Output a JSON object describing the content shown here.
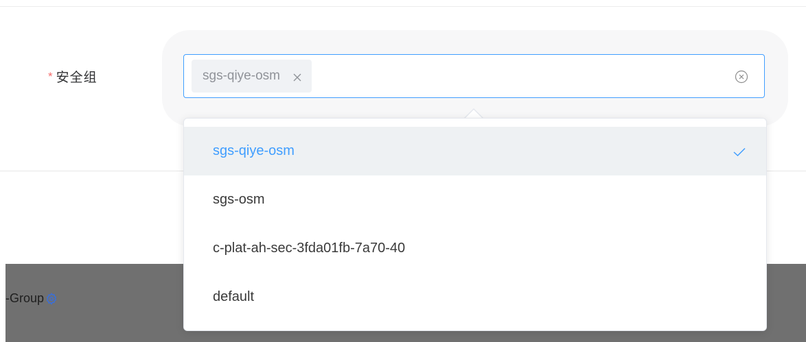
{
  "form": {
    "required_mark": "*",
    "label": "安全组"
  },
  "select": {
    "tags": [
      {
        "label": "sgs-qiye-osm"
      }
    ],
    "accent_color": "#409eff"
  },
  "dropdown": {
    "options": [
      {
        "label": "sgs-qiye-osm",
        "selected": true
      },
      {
        "label": "sgs-osm",
        "selected": false
      },
      {
        "label": "c-plat-ah-sec-3fda01fb-7a70-40",
        "selected": false
      },
      {
        "label": "default",
        "selected": false
      }
    ]
  },
  "background": {
    "group_label": "-Group"
  }
}
